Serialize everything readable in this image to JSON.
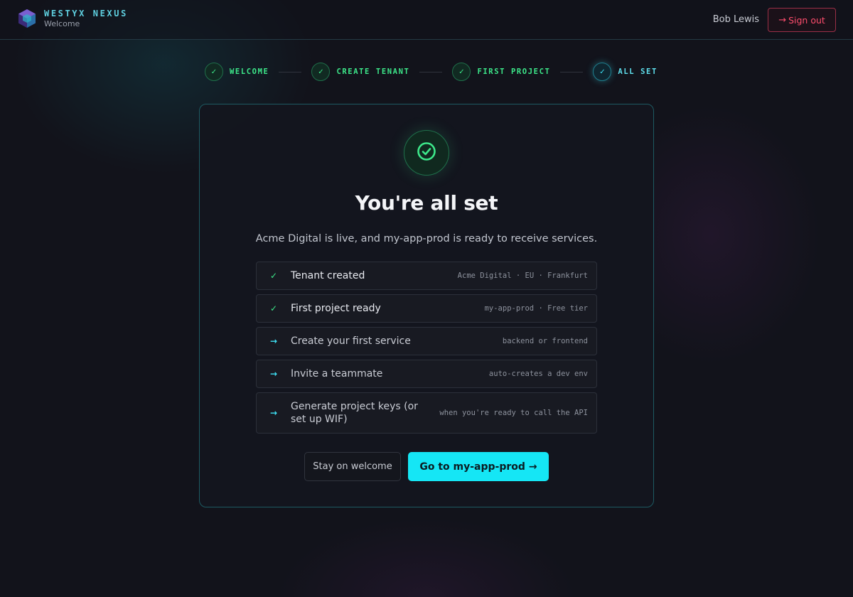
{
  "header": {
    "brand": "WESTYX NEXUS",
    "subtitle": "Welcome",
    "user_name": "Bob Lewis",
    "sign_out_label": "Sign out",
    "sign_out_icon": "→"
  },
  "stepper": {
    "steps": [
      {
        "label": "WELCOME",
        "status": "complete",
        "icon": "✓"
      },
      {
        "label": "CREATE TENANT",
        "status": "complete",
        "icon": "✓"
      },
      {
        "label": "FIRST PROJECT",
        "status": "complete",
        "icon": "✓"
      },
      {
        "label": "ALL SET",
        "status": "current",
        "icon": "✓"
      }
    ]
  },
  "card": {
    "title": "You're all set",
    "subtitle": "Acme Digital is live, and my-app-prod is ready to receive services.",
    "checklist": [
      {
        "icon": "✓",
        "status": "done",
        "label": "Tenant created",
        "meta": "Acme Digital · EU · Frankfurt"
      },
      {
        "icon": "✓",
        "status": "done",
        "label": "First project ready",
        "meta": "my-app-prod · Free tier"
      },
      {
        "icon": "→",
        "status": "todo",
        "label": "Create your first service",
        "meta": "backend or frontend"
      },
      {
        "icon": "→",
        "status": "todo",
        "label": "Invite a teammate",
        "meta": "auto-creates a dev env"
      },
      {
        "icon": "→",
        "status": "todo",
        "label": "Generate project keys (or set up WIF)",
        "meta": "when you're ready to call the API"
      }
    ],
    "stay_button": "Stay on welcome",
    "go_button": "Go to my-app-prod",
    "go_button_arrow": "→"
  },
  "colors": {
    "accent": "#15e6f5",
    "success": "#3de88a",
    "danger": "#ff4d6d",
    "background": "#12131b"
  }
}
